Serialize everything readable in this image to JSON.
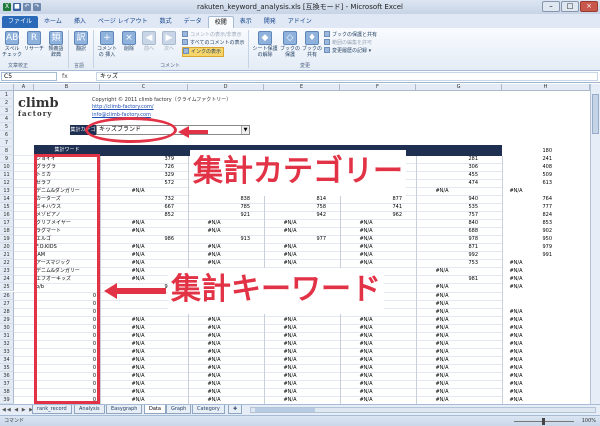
{
  "window": {
    "title": "rakuten_keyword_analysis.xls [互換モード] - Microsoft Excel",
    "controls": [
      "–",
      "□",
      "×"
    ]
  },
  "qat": {
    "icons": [
      "excel-icon",
      "save-icon",
      "undo-icon",
      "redo-icon"
    ]
  },
  "tabs": [
    "ファイル",
    "ホーム",
    "挿入",
    "ページ レイアウト",
    "数式",
    "データ",
    "校閲",
    "表示",
    "開発",
    "アドイン"
  ],
  "ribbon": {
    "buttons": [
      {
        "label": "スペル チェック",
        "icon": "ABC"
      },
      {
        "label": "リサーチ",
        "icon": "R"
      },
      {
        "label": "類義語 辞典",
        "icon": "類"
      },
      {
        "label": "翻訳",
        "icon": "訳"
      },
      {
        "label": "コメントの 挿入",
        "icon": "+"
      },
      {
        "label": "削除",
        "icon": "×"
      },
      {
        "label": "前へ",
        "icon": "◀"
      },
      {
        "label": "次へ",
        "icon": "▶"
      },
      {
        "label": "シート保護 の解除",
        "icon": "◆"
      },
      {
        "label": "ブックの 保護",
        "icon": "◇"
      },
      {
        "label": "ブックの 共有",
        "icon": "♦"
      }
    ],
    "small": [
      "コメントの表示/非表示",
      "すべてのコメントの表示",
      "インクの表示",
      "ブックの保護と共有",
      "範囲の編集を許可",
      "変更履歴の記録 ▾"
    ],
    "groups": [
      "文章校正",
      "言語",
      "コメント",
      "変更"
    ]
  },
  "formula_bar": {
    "name_box": "C5",
    "fx": "fx",
    "value": "キッズ"
  },
  "columns": [
    "A",
    "B",
    "C",
    "D",
    "E",
    "F",
    "G",
    "H"
  ],
  "rows": [
    1,
    2,
    3,
    4,
    5,
    6,
    7,
    8,
    9,
    10,
    11,
    12,
    13,
    14,
    15,
    16,
    17,
    18,
    19,
    20,
    21,
    22,
    23,
    24,
    25,
    26,
    27,
    28,
    29,
    30,
    31,
    32,
    33,
    34,
    35,
    36,
    37,
    38,
    39,
    40,
    41
  ],
  "sheet": {
    "logo_top": "climb",
    "logo_bottom": "factory",
    "copyright": "Copyright © 2011 climb factory（クライムファクトリー）",
    "url": "http://climb-factory.com/",
    "email": "info@climb-factory.com",
    "category_label": "集計カテゴリ",
    "category_value": "キッズブランド",
    "header_keyword": "集計ワード",
    "date_headers": [
      "2011-11-28 to 2011-12-04",
      "2011-12-05 to 2011-12-11",
      "2011-12-12 to 2011-12-18",
      "2011-12-19 to 2011-12-25",
      "2012-01-02 to 2012-01-08",
      "2012-01-09 to 2012-01-15"
    ],
    "keywords": [
      "JENNI",
      "ジョイイ",
      "グラグラ",
      "トミカ",
      "セラフ",
      "デニム&ダンガリー",
      "カーターズ",
      "ミキハウス",
      "メゾピアノ",
      "クリフメイヤー",
      "ラグマート",
      "エルゴ",
      "F.O.KIDS",
      "JAM",
      "アースマジック",
      "デニム&ダンガリー",
      "エフオーキッズ",
      "b/b",
      "0",
      "0",
      "0",
      "0",
      "0",
      "0",
      "0",
      "0",
      "0",
      "0",
      "0",
      "0",
      "0",
      "0",
      "0",
      "0"
    ],
    "values": [
      [
        "760",
        "",
        "",
        "",
        "149",
        "180"
      ],
      [
        "379",
        "47",
        "",
        "65",
        "281",
        "241"
      ],
      [
        "726",
        "91",
        "",
        "800",
        "306",
        "408"
      ],
      [
        "329",
        "27",
        "",
        "304",
        "455",
        "509"
      ],
      [
        "572",
        "659",
        "",
        "731",
        "474",
        "613"
      ],
      [
        "#N/A",
        "#N/A",
        "#N/A",
        "#N/A",
        "#N/A",
        "#N/A"
      ],
      [
        "732",
        "838",
        "814",
        "877",
        "940",
        "764"
      ],
      [
        "667",
        "785",
        "758",
        "741",
        "535",
        "777"
      ],
      [
        "852",
        "921",
        "942",
        "962",
        "757",
        "824"
      ],
      [
        "#N/A",
        "#N/A",
        "#N/A",
        "#N/A",
        "840",
        "853"
      ],
      [
        "#N/A",
        "#N/A",
        "#N/A",
        "#N/A",
        "688",
        "902"
      ],
      [
        "986",
        "913",
        "977",
        "#N/A",
        "978",
        "950"
      ],
      [
        "#N/A",
        "#N/A",
        "#N/A",
        "#N/A",
        "871",
        "979"
      ],
      [
        "#N/A",
        "#N/A",
        "#N/A",
        "#N/A",
        "992",
        "991"
      ],
      [
        "#N/A",
        "#N/A",
        "#N/A",
        "#N/A",
        "753",
        "#N/A"
      ],
      [
        "#N/A",
        "#N/A",
        "#N/A",
        "#N/A",
        "#N/A",
        "#N/A"
      ],
      [
        "#N/A",
        "#N/A",
        "#N/A",
        "#N/A",
        "981",
        "#N/A"
      ],
      [
        "987",
        "",
        "",
        "",
        "#N/A",
        "#N/A"
      ],
      [
        "",
        "",
        "",
        "#N/A",
        "#N/A",
        ""
      ],
      [
        "",
        "",
        "",
        "#N/A",
        "#N/A",
        ""
      ],
      [
        "",
        "",
        "",
        "#N/A",
        "#N/A",
        "#N/A"
      ],
      [
        "#N/A",
        "#N/A",
        "#N/A",
        "#N/A",
        "#N/A",
        "#N/A"
      ],
      [
        "#N/A",
        "#N/A",
        "#N/A",
        "#N/A",
        "#N/A",
        "#N/A"
      ],
      [
        "#N/A",
        "#N/A",
        "#N/A",
        "#N/A",
        "#N/A",
        "#N/A"
      ],
      [
        "#N/A",
        "#N/A",
        "#N/A",
        "#N/A",
        "#N/A",
        "#N/A"
      ],
      [
        "#N/A",
        "#N/A",
        "#N/A",
        "#N/A",
        "#N/A",
        "#N/A"
      ],
      [
        "#N/A",
        "#N/A",
        "#N/A",
        "#N/A",
        "#N/A",
        "#N/A"
      ],
      [
        "#N/A",
        "#N/A",
        "#N/A",
        "#N/A",
        "#N/A",
        "#N/A"
      ],
      [
        "#N/A",
        "#N/A",
        "#N/A",
        "#N/A",
        "#N/A",
        "#N/A"
      ],
      [
        "#N/A",
        "#N/A",
        "#N/A",
        "#N/A",
        "#N/A",
        "#N/A"
      ],
      [
        "#N/A",
        "#N/A",
        "#N/A",
        "#N/A",
        "#N/A",
        "#N/A"
      ],
      [
        "#N/A",
        "#N/A",
        "#N/A",
        "#N/A",
        "#N/A",
        "#N/A"
      ],
      [
        "#N/A",
        "#N/A",
        "#N/A",
        "#N/A",
        "#N/A",
        "#N/A"
      ],
      [
        "#N/A",
        "#N/A",
        "#N/A",
        "#N/A",
        "#N/A",
        "#N/A"
      ]
    ]
  },
  "annotations": {
    "category": "集計カテゴリー",
    "keywords": "集計キーワード",
    "color": "#e23246"
  },
  "sheet_tabs": [
    "rank_record",
    "Analysis",
    "Easygraph",
    "Data",
    "Graph",
    "Category"
  ],
  "active_sheet": "Data",
  "status": {
    "left": "コマンド",
    "zoom": "100%"
  }
}
